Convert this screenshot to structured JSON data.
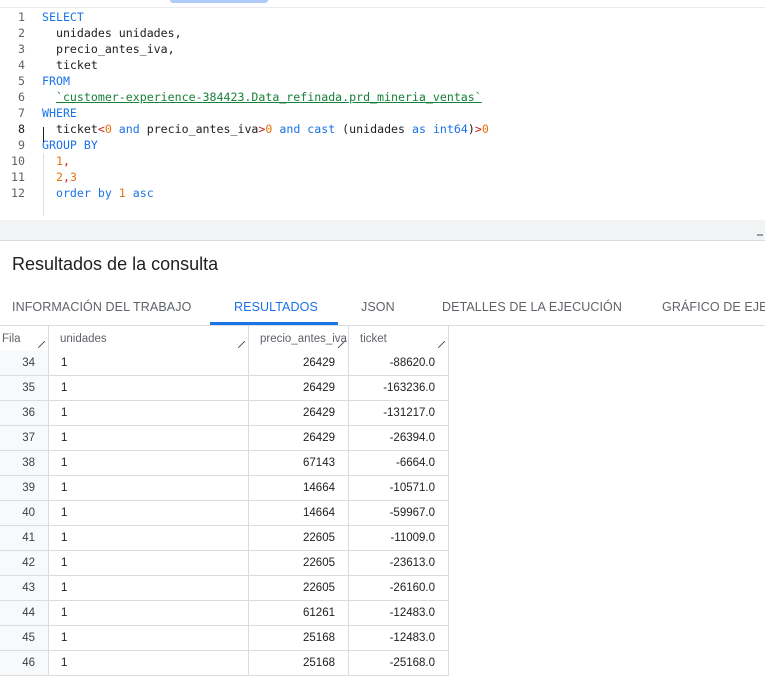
{
  "editor": {
    "lines": [
      {
        "n": "1",
        "tokens": [
          {
            "t": "SELECT",
            "c": "kw"
          }
        ]
      },
      {
        "n": "2",
        "tokens": [
          {
            "t": "  unidades unidades,",
            "c": "id"
          }
        ]
      },
      {
        "n": "3",
        "tokens": [
          {
            "t": "  precio_antes_iva,",
            "c": "id"
          }
        ]
      },
      {
        "n": "4",
        "tokens": [
          {
            "t": "  ticket",
            "c": "id"
          }
        ]
      },
      {
        "n": "5",
        "tokens": [
          {
            "t": "FROM",
            "c": "kw"
          }
        ]
      },
      {
        "n": "6",
        "tokens": [
          {
            "t": "  ",
            "c": "id"
          },
          {
            "t": "`customer-experience-384423.Data_refinada.prd_mineria_ventas`",
            "c": "str"
          }
        ]
      },
      {
        "n": "7",
        "tokens": [
          {
            "t": "WHERE",
            "c": "kw"
          }
        ]
      },
      {
        "n": "8",
        "tokens": [
          {
            "t": "  ticket",
            "c": "id"
          },
          {
            "t": "<",
            "c": "op"
          },
          {
            "t": "0",
            "c": "num"
          },
          {
            "t": " and ",
            "c": "kw"
          },
          {
            "t": "precio_antes_iva",
            "c": "id"
          },
          {
            "t": ">",
            "c": "op"
          },
          {
            "t": "0",
            "c": "num"
          },
          {
            "t": " and ",
            "c": "kw"
          },
          {
            "t": "cast",
            "c": "kw"
          },
          {
            "t": " (unidades ",
            "c": "id"
          },
          {
            "t": "as",
            "c": "kw"
          },
          {
            "t": " ",
            "c": "id"
          },
          {
            "t": "int64",
            "c": "kw"
          },
          {
            "t": ")",
            "c": "id"
          },
          {
            "t": ">",
            "c": "op"
          },
          {
            "t": "0",
            "c": "num"
          }
        ]
      },
      {
        "n": "9",
        "tokens": [
          {
            "t": "GROUP BY",
            "c": "kw"
          }
        ]
      },
      {
        "n": "10",
        "tokens": [
          {
            "t": "  ",
            "c": "id"
          },
          {
            "t": "1",
            "c": "num"
          },
          {
            "t": ",",
            "c": "op"
          }
        ]
      },
      {
        "n": "11",
        "tokens": [
          {
            "t": "  ",
            "c": "id"
          },
          {
            "t": "2",
            "c": "num"
          },
          {
            "t": ",",
            "c": "op"
          },
          {
            "t": "3",
            "c": "num"
          }
        ]
      },
      {
        "n": "12",
        "tokens": [
          {
            "t": "  order by ",
            "c": "kw"
          },
          {
            "t": "1",
            "c": "num"
          },
          {
            "t": " asc",
            "c": "kw"
          }
        ]
      }
    ],
    "current_line": "8"
  },
  "results": {
    "title": "Resultados de la consulta",
    "tabs": [
      {
        "label": "INFORMACIÓN DEL TRABAJO",
        "active": false
      },
      {
        "label": "RESULTADOS",
        "active": true
      },
      {
        "label": "JSON",
        "active": false
      },
      {
        "label": "DETALLES DE LA EJECUCIÓN",
        "active": false
      },
      {
        "label": "GRÁFICO DE EJEC",
        "active": false
      }
    ],
    "columns": [
      "Fila",
      "unidades",
      "precio_antes_iva",
      "ticket"
    ],
    "rows": [
      [
        "34",
        "1",
        "26429",
        "-88620.0"
      ],
      [
        "35",
        "1",
        "26429",
        "-163236.0"
      ],
      [
        "36",
        "1",
        "26429",
        "-131217.0"
      ],
      [
        "37",
        "1",
        "26429",
        "-26394.0"
      ],
      [
        "38",
        "1",
        "67143",
        "-6664.0"
      ],
      [
        "39",
        "1",
        "14664",
        "-10571.0"
      ],
      [
        "40",
        "1",
        "14664",
        "-59967.0"
      ],
      [
        "41",
        "1",
        "22605",
        "-11009.0"
      ],
      [
        "42",
        "1",
        "22605",
        "-23613.0"
      ],
      [
        "43",
        "1",
        "22605",
        "-26160.0"
      ],
      [
        "44",
        "1",
        "61261",
        "-12483.0"
      ],
      [
        "45",
        "1",
        "25168",
        "-12483.0"
      ],
      [
        "46",
        "1",
        "25168",
        "-25168.0"
      ]
    ]
  }
}
